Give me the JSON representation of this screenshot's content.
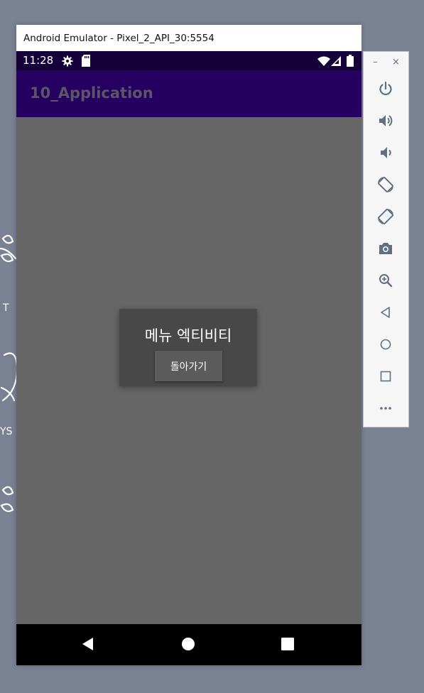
{
  "window": {
    "title": "Android Emulator - Pixel_2_API_30:5554"
  },
  "statusbar": {
    "time": "11:28",
    "icons": [
      "settings-icon",
      "sd-card-icon",
      "wifi-icon",
      "signal-icon",
      "battery-icon"
    ]
  },
  "appbar": {
    "title": "10_Application"
  },
  "dialog": {
    "title": "메뉴 엑티비티",
    "button_label": "돌아가기"
  },
  "navbar": {
    "buttons": [
      "back-icon",
      "home-icon",
      "overview-icon"
    ]
  },
  "toolbar": {
    "minimize": "–",
    "close": "×",
    "buttons": [
      "power-icon",
      "volume-up-icon",
      "volume-down-icon",
      "rotate-left-icon",
      "rotate-right-icon",
      "camera-icon",
      "zoom-icon",
      "back-icon",
      "home-icon",
      "overview-icon",
      "more-icon"
    ]
  },
  "colors": {
    "desktop": "#7a8192",
    "statusbar": "#16003a",
    "appbar": "#250061",
    "content": "#666666",
    "dialog": "#484848",
    "toolbar": "#f6f6f6",
    "toolbar_icon": "#607080"
  }
}
